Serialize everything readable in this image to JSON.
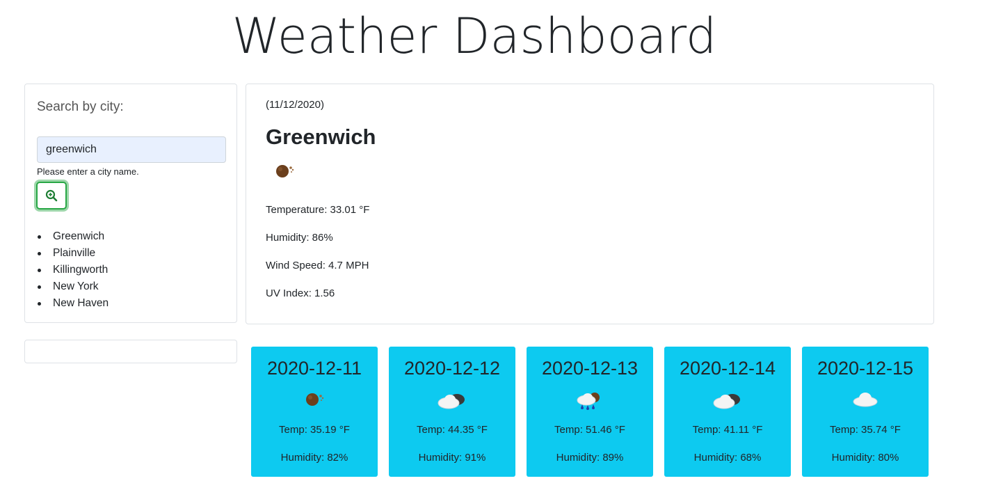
{
  "page": {
    "title": "Weather Dashboard"
  },
  "search": {
    "label": "Search by city:",
    "value": "greenwich",
    "hint": "Please enter a city name.",
    "button_icon": "search-icon"
  },
  "history": [
    "Greenwich",
    "Plainville",
    "Killingworth",
    "New York",
    "New Haven"
  ],
  "current": {
    "date": "(11/12/2020)",
    "city": "Greenwich",
    "icon": "brown-moon-dust-icon",
    "temperature": "Temperature: 33.01 °F",
    "humidity": "Humidity: 86%",
    "wind": "Wind Speed: 4.7 MPH",
    "uv": "UV Index: 1.56"
  },
  "forecast": [
    {
      "date": "2020-12-11",
      "icon": "dusty-moon-icon",
      "temp": "Temp: 35.19 °F",
      "humidity": "Humidity: 82%"
    },
    {
      "date": "2020-12-12",
      "icon": "partly-cloudy-icon",
      "temp": "Temp: 44.35 °F",
      "humidity": "Humidity: 91%"
    },
    {
      "date": "2020-12-13",
      "icon": "rain-cloud-icon",
      "temp": "Temp: 51.46 °F",
      "humidity": "Humidity: 89%"
    },
    {
      "date": "2020-12-14",
      "icon": "partly-cloudy-icon",
      "temp": "Temp: 41.11 °F",
      "humidity": "Humidity: 68%"
    },
    {
      "date": "2020-12-15",
      "icon": "cloud-icon",
      "temp": "Temp: 35.74 °F",
      "humidity": "Humidity: 80%"
    }
  ],
  "colors": {
    "forecast_bg": "#0dcaf0",
    "search_button_border": "#28a745",
    "input_bg": "#e8f0fe"
  }
}
